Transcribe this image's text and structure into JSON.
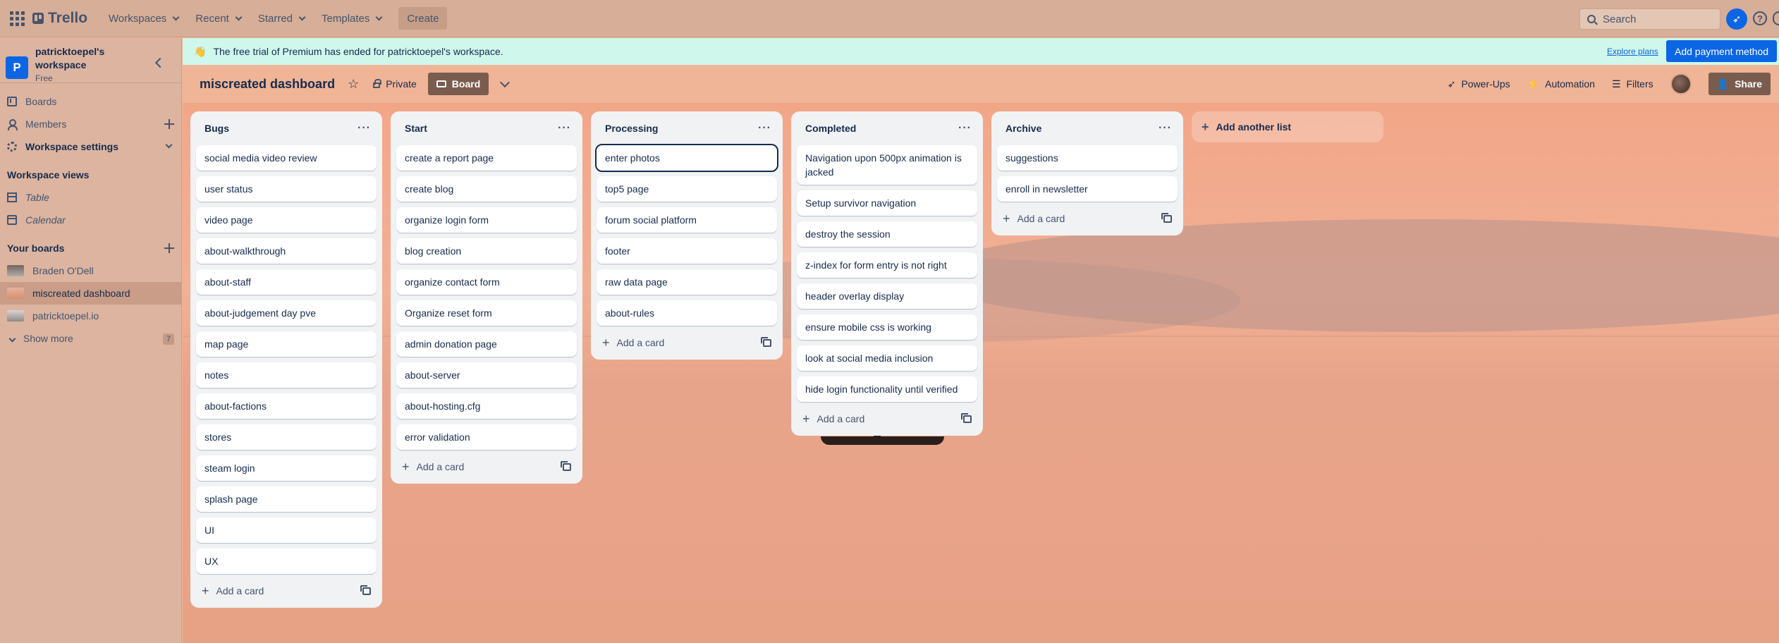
{
  "topnav": {
    "logo": "Trello",
    "menus": [
      "Workspaces",
      "Recent",
      "Starred",
      "Templates"
    ],
    "create": "Create",
    "search_placeholder": "Search"
  },
  "sidebar": {
    "workspace_name": "patricktoepel's workspace",
    "plan": "Free",
    "nav": [
      {
        "label": "Boards",
        "icon": "board-icon"
      },
      {
        "label": "Members",
        "icon": "member-icon"
      },
      {
        "label": "Workspace settings",
        "icon": "gear-icon"
      }
    ],
    "views_heading": "Workspace views",
    "views": [
      {
        "label": "Table",
        "icon": "table-icon"
      },
      {
        "label": "Calendar",
        "icon": "calendar-icon"
      }
    ],
    "boards_heading": "Your boards",
    "boards": [
      {
        "label": "Braden O'Dell",
        "color": "#8c7f7a"
      },
      {
        "label": "miscreated dashboard",
        "color": "#e0a186"
      },
      {
        "label": "patricktoepel.io",
        "color": "#a9a6a4"
      }
    ],
    "show_more": "Show more",
    "show_more_count": "7"
  },
  "banner": {
    "emoji": "👋",
    "message": "The free trial of Premium has ended for patricktoepel's workspace.",
    "explore": "Explore plans",
    "pay": "Add payment method"
  },
  "board": {
    "title": "miscreated dashboard",
    "visibility": "Private",
    "view": "Board",
    "power_ups": "Power-Ups",
    "automation": "Automation",
    "filters": "Filters",
    "share": "Share",
    "add_list": "Add another list"
  },
  "lists": [
    {
      "title": "Bugs",
      "add": "Add a card",
      "cards": [
        "social media video review",
        "user status",
        "video page",
        "about-walkthrough",
        "about-staff",
        "about-judgement day pve",
        "map page",
        "notes",
        "about-factions",
        "stores",
        "steam login",
        "splash page",
        "UI",
        "UX"
      ]
    },
    {
      "title": "Start",
      "add": "Add a card",
      "cards": [
        "create a report page",
        "create blog",
        "organize login form",
        "blog creation",
        "organize contact form",
        "Organize reset form",
        "admin donation page",
        "about-server",
        "about-hosting.cfg",
        "error validation"
      ]
    },
    {
      "title": "Processing",
      "add": "Add a card",
      "cards": [
        "enter photos",
        "top5 page",
        "forum social platform",
        "footer",
        "raw data page",
        "about-rules"
      ]
    },
    {
      "title": "Completed",
      "add": "Add a card",
      "cards": [
        "Navigation upon 500px animation is jacked",
        "Setup survivor navigation",
        "destroy the session",
        "z-index for form entry is not right",
        "header overlay display",
        "ensure mobile css is working",
        "look at social media inclusion",
        "hide login functionality until verified"
      ]
    },
    {
      "title": "Archive",
      "add": "Add a card",
      "cards": [
        "suggestions",
        "enroll in newsletter"
      ]
    }
  ],
  "colors": {
    "accent": "#0c66e4",
    "list_bg": "#f1f2f4",
    "board_button": "#7a5c4e"
  }
}
